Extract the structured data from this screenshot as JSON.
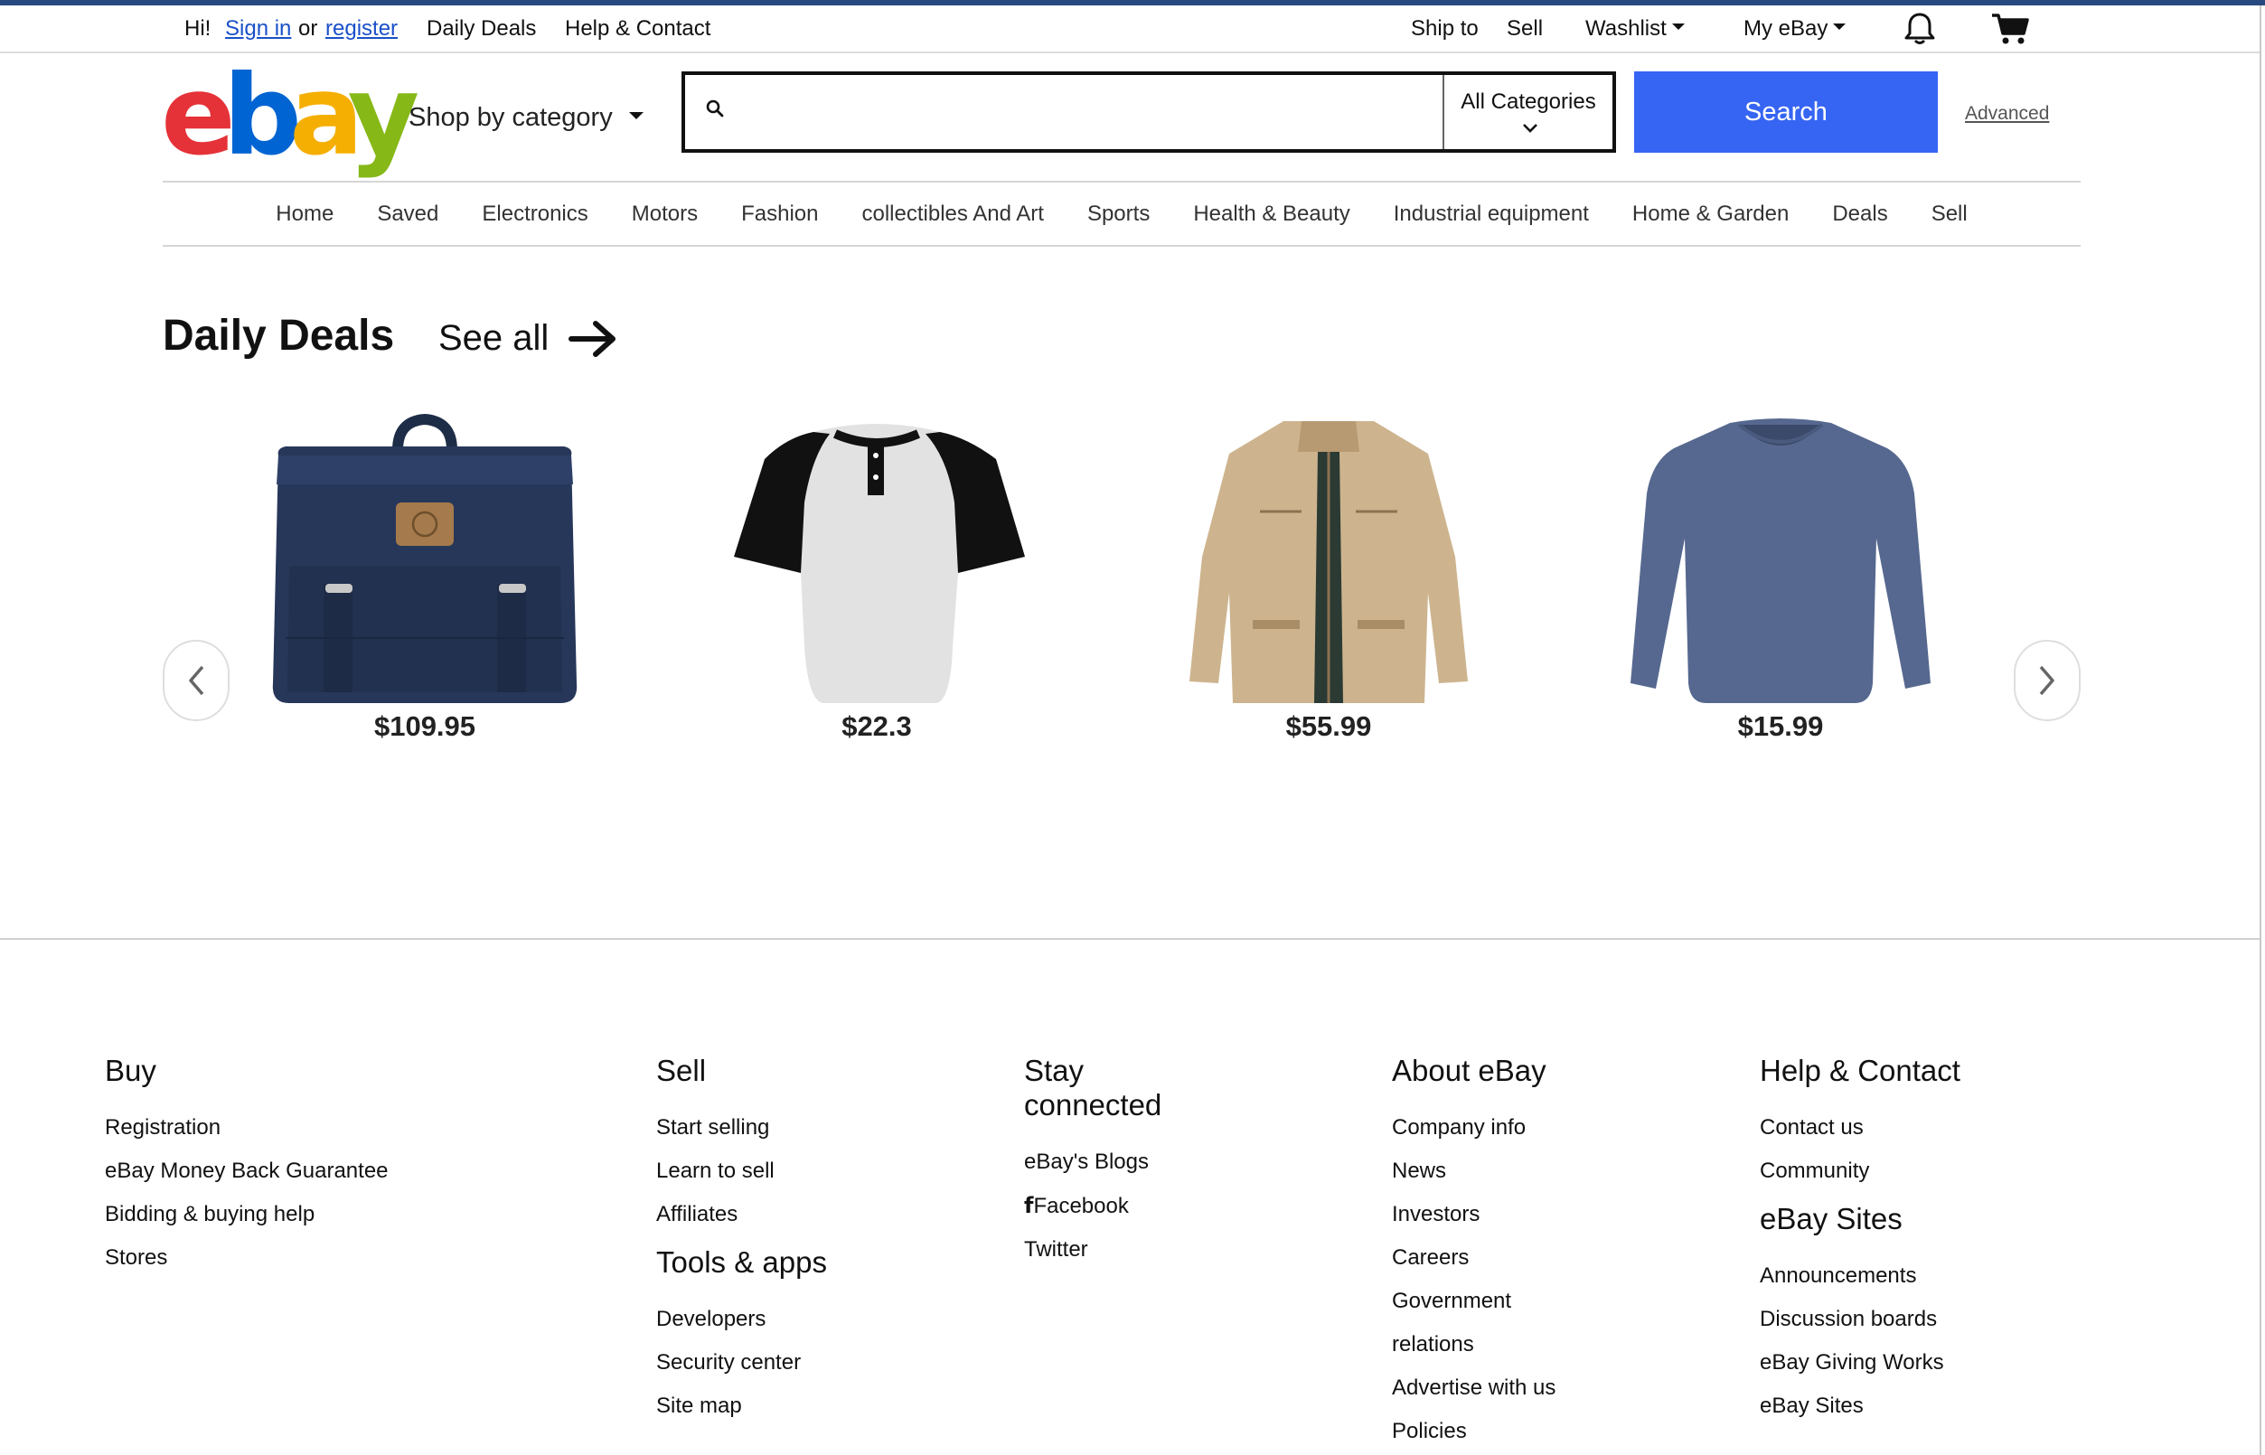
{
  "topbar": {
    "greeting": "Hi!",
    "sign_in": "Sign in",
    "or": "or",
    "register": "register",
    "daily_deals": "Daily Deals",
    "help_contact": "Help & Contact",
    "ship_to": "Ship to",
    "sell": "Sell",
    "watchlist": "Washlist",
    "my_ebay": "My eBay",
    "icons": [
      "bell-icon",
      "cart-icon"
    ]
  },
  "header": {
    "logo": {
      "e": "e",
      "b": "b",
      "a": "a",
      "y": "y"
    },
    "shop_by_category": "Shop by category",
    "search_placeholder": "",
    "search_value": "",
    "category_select": "All Categories",
    "search_button": "Search",
    "advanced": "Advanced"
  },
  "colors": {
    "brand_red": "#e53238",
    "brand_blue": "#0064d2",
    "brand_yellow": "#f5af02",
    "brand_green": "#86b817",
    "search_button": "#3665f3",
    "top_stripe": "#27497f"
  },
  "nav": {
    "items": [
      "Home",
      "Saved",
      "Electronics",
      "Motors",
      "Fashion",
      "collectibles And Art",
      "Sports",
      "Health & Beauty",
      "Industrial equipment",
      "Home & Garden",
      "Deals",
      "Sell"
    ]
  },
  "deals": {
    "title": "Daily Deals",
    "see_all": "See all",
    "items": [
      {
        "product": "backpack",
        "price": "$109.95"
      },
      {
        "product": "raglan-henley-shirt",
        "price": "$22.3"
      },
      {
        "product": "khaki-jacket",
        "price": "$55.99"
      },
      {
        "product": "long-sleeve-shirt",
        "price": "$15.99"
      }
    ]
  },
  "footer": {
    "buy": {
      "title": "Buy",
      "items": [
        "Registration",
        "eBay Money Back Guarantee",
        "Bidding & buying help",
        "Stores"
      ]
    },
    "sell": {
      "title": "Sell",
      "items": [
        "Start selling",
        "Learn to sell",
        "Affiliates"
      ]
    },
    "tools": {
      "title": "Tools & apps",
      "items": [
        "Developers",
        "Security center",
        "Site map"
      ]
    },
    "stay": {
      "title_line1": "Stay",
      "title_line2": "connected",
      "items": [
        "eBay's Blogs",
        "Facebook",
        "Twitter"
      ]
    },
    "about": {
      "title": "About eBay",
      "items": [
        "Company info",
        "News",
        "Investors",
        "Careers",
        "Government",
        "relations",
        "Advertise with us",
        "Policies"
      ]
    },
    "help": {
      "title": "Help & Contact",
      "items": [
        "Contact us",
        "Community"
      ]
    },
    "sites": {
      "title": "eBay Sites",
      "items": [
        "Announcements",
        "Discussion boards",
        "eBay Giving Works",
        "eBay Sites"
      ]
    }
  }
}
